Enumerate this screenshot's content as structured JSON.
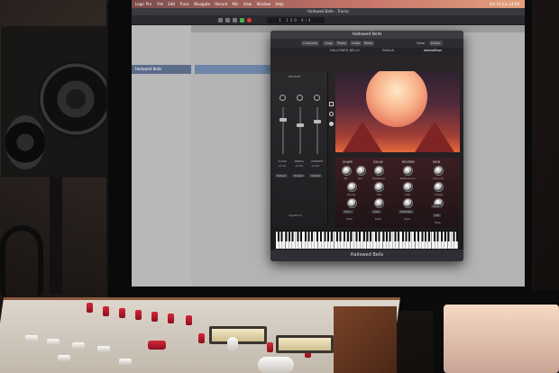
{
  "menubar": {
    "app": "Logic Pro",
    "items": [
      "File",
      "Edit",
      "Track",
      "Navigate",
      "Record",
      "Mix",
      "View",
      "Window",
      "Help"
    ],
    "clock": "Sat 20 Jun 14:09"
  },
  "window_title": "Hallowed Bells - Tracks",
  "transport_display": "1 120 4/4",
  "plugin": {
    "title": "Hallowed Bells",
    "toolbar": {
      "compare": "Compare",
      "copy": "Copy",
      "paste": "Paste",
      "undo": "Undo",
      "redo": "Redo",
      "view_label": "View:",
      "view_value": "Editor"
    },
    "preset": "Default",
    "brand_left": "HALLOWED BELLS",
    "brand_right": "eblendflow",
    "mixer": {
      "header": "BROWSE",
      "channels": [
        {
          "name": "CLOSE",
          "value": "+0.00",
          "output": "Output"
        },
        {
          "name": "BREEA",
          "value": "+0.00",
          "output": "Output"
        },
        {
          "name": "AMBIENT",
          "value": "+0.00",
          "output": "Output"
        }
      ],
      "footer": "Signature"
    },
    "fx": {
      "sections": [
        "SHAPE",
        "DELAY",
        "REVERB",
        "MOD"
      ],
      "row1": [
        "Att",
        "Rel",
        "Feedback",
        "Reflections",
        "Amount"
      ],
      "row2": [
        "Decay",
        "Mix",
        "Size",
        "Shape"
      ],
      "row3": [
        "Pitch",
        "Rate",
        "Type",
        "Rate"
      ],
      "selects": [
        "Oct+",
        "1/4n",
        "Intimate",
        "Slow",
        "1/4"
      ]
    },
    "footer_name": "Hallowed Bells"
  },
  "colors": {
    "menubar_start": "#7a4c4c",
    "menubar_end": "#e2a07b",
    "sun": "#f7b189",
    "fx_bg": "#3b1e22",
    "console_red": "#d6283a"
  }
}
